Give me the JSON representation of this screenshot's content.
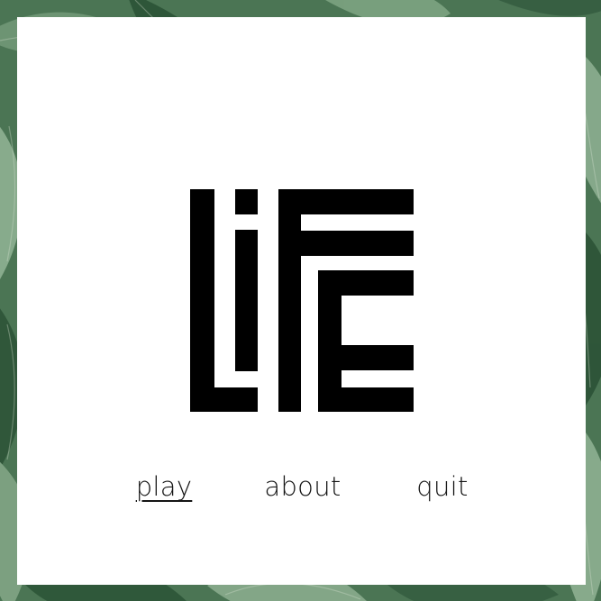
{
  "logo": {
    "text": "LIFE",
    "color": "#000000"
  },
  "menu": {
    "items": [
      {
        "id": "play",
        "label": "play",
        "selected": true
      },
      {
        "id": "about",
        "label": "about",
        "selected": false
      },
      {
        "id": "quit",
        "label": "quit",
        "selected": false
      }
    ]
  },
  "colors": {
    "panel": "#ffffff",
    "leaf_dark": "#2f5a3d",
    "leaf_light": "#8fae91",
    "border_shadow": "#d9dfd5",
    "text": "#151515"
  }
}
